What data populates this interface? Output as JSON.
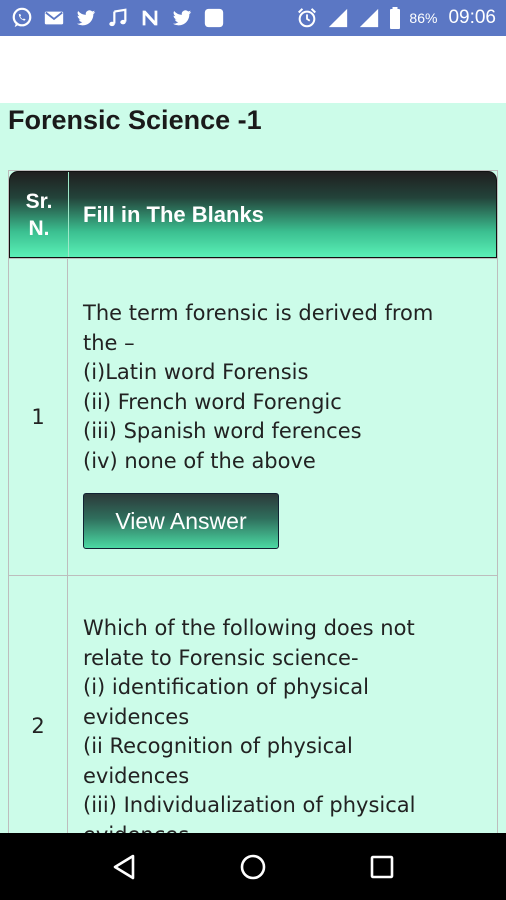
{
  "status_bar": {
    "battery_percent": "86%",
    "time": "09:06",
    "notification_icons": [
      "whatsapp-icon",
      "email-icon",
      "twitter-icon",
      "music-note-icon",
      "n-app-icon",
      "twitter-icon",
      "square-app-icon"
    ],
    "system_icons": [
      "alarm-icon",
      "signal-icon",
      "signal-icon",
      "battery-icon"
    ]
  },
  "page": {
    "title": "Forensic Science -1"
  },
  "table": {
    "header": {
      "sr_line1": "Sr.",
      "sr_line2": "N.",
      "title": "Fill in The Blanks"
    },
    "rows": [
      {
        "sr": "1",
        "lines": [
          "The term forensic is derived from",
          "the –",
          "(i)Latin word Forensis",
          "(ii) French word Forengic",
          "(iii) Spanish word ferences",
          "(iv) none of the above"
        ],
        "button": "View Answer"
      },
      {
        "sr": "2",
        "lines": [
          "Which of the following does not",
          "relate to Forensic science-",
          "(i) identification of physical",
          "evidences",
          "(ii Recognition of physical",
          "evidences",
          "(iii) Individualization of physical",
          "evidences"
        ]
      }
    ]
  },
  "nav": {
    "back": "back-icon",
    "home": "home-icon",
    "recents": "recents-icon"
  },
  "colors": {
    "status_bar": "#5b77c4",
    "background": "#ccfce9",
    "header_gradient_end": "#5af0b6"
  }
}
